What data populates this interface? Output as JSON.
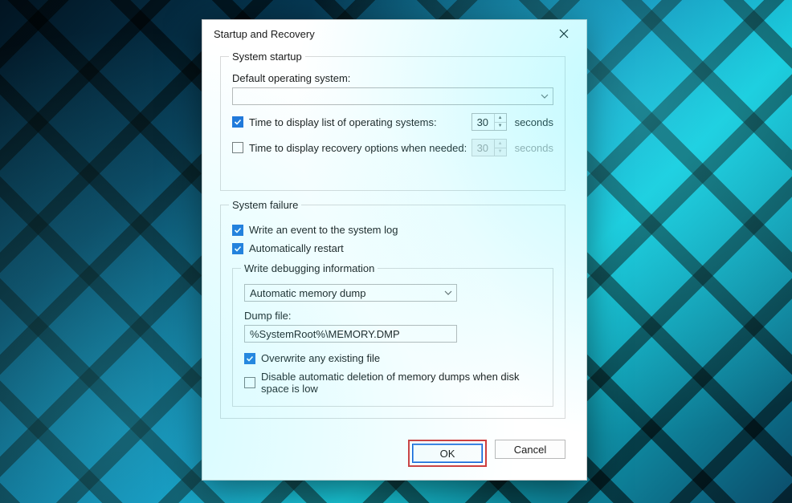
{
  "dialog": {
    "title": "Startup and Recovery"
  },
  "startup": {
    "legend": "System startup",
    "default_os_label": "Default operating system:",
    "default_os_value": "",
    "time_list": {
      "checked": true,
      "label": "Time to display list of operating systems:",
      "value": "30",
      "unit": "seconds"
    },
    "time_recovery": {
      "checked": false,
      "label": "Time to display recovery options when needed:",
      "value": "30",
      "unit": "seconds"
    }
  },
  "failure": {
    "legend": "System failure",
    "write_event": {
      "checked": true,
      "label": "Write an event to the system log"
    },
    "auto_restart": {
      "checked": true,
      "label": "Automatically restart"
    },
    "debug": {
      "legend": "Write debugging information",
      "mode": "Automatic memory dump",
      "dump_file_label": "Dump file:",
      "dump_file_value": "%SystemRoot%\\MEMORY.DMP",
      "overwrite": {
        "checked": true,
        "label": "Overwrite any existing file"
      },
      "disable_delete": {
        "checked": false,
        "label": "Disable automatic deletion of memory dumps when disk space is low"
      }
    }
  },
  "buttons": {
    "ok": "OK",
    "cancel": "Cancel"
  }
}
